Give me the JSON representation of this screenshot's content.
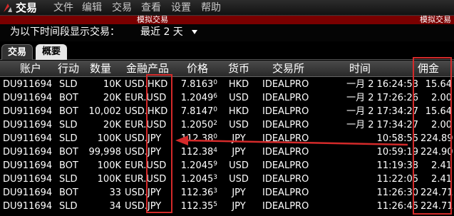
{
  "app": {
    "title": "交易"
  },
  "menu": [
    "文件",
    "编辑",
    "交易",
    "查看",
    "设置",
    "帮助"
  ],
  "simulated_banner": "模拟交易",
  "filter": {
    "label": "为以下时间段显示交易：",
    "value": "最近 2 天"
  },
  "tabs": [
    {
      "label": "交易",
      "active": true
    },
    {
      "label": "概要",
      "active": false
    }
  ],
  "columns": [
    "账户",
    "行动",
    "数量",
    "金融产品",
    "价格",
    "货币",
    "交易所",
    "时间",
    "佣金"
  ],
  "rows": [
    {
      "account": "DU911694",
      "action": "SLD",
      "qty": "10K",
      "symbol": "USD.HKD",
      "price_main": "7.8163",
      "price_sup": "0",
      "currency": "HKD",
      "exchange": "IDEALPRO",
      "time": "一月 2 16:24:53",
      "commission": "15.64"
    },
    {
      "account": "DU911694",
      "action": "BOT",
      "qty": "20K",
      "symbol": "EUR.USD",
      "price_main": "1.2049",
      "price_sup": "6",
      "currency": "USD",
      "exchange": "IDEALPRO",
      "time": "一月 2 17:26:26",
      "commission": "2.00"
    },
    {
      "account": "DU911694",
      "action": "BOT",
      "qty": "10,002",
      "symbol": "USD.HKD",
      "price_main": "7.8147",
      "price_sup": "0",
      "currency": "HKD",
      "exchange": "IDEALPRO",
      "time": "一月 2 17:34:27",
      "commission": "15.64"
    },
    {
      "account": "DU911694",
      "action": "SLD",
      "qty": "20K",
      "symbol": "EUR.USD",
      "price_main": "1.2050",
      "price_sup": "2",
      "currency": "USD",
      "exchange": "IDEALPRO",
      "time": "一月 2 17:34:27",
      "commission": "2.00"
    },
    {
      "account": "DU911694",
      "action": "SLD",
      "qty": "100K",
      "symbol": "USD.JPY",
      "price_main": "112.38",
      "price_sup": "0",
      "currency": "JPY",
      "exchange": "IDEALPRO",
      "time": "10:58:55",
      "commission": "224.89"
    },
    {
      "account": "DU911694",
      "action": "BOT",
      "qty": "99,998",
      "symbol": "USD.JPY",
      "price_main": "112.38",
      "price_sup": "4",
      "currency": "JPY",
      "exchange": "IDEALPRO",
      "time": "10:59:19",
      "commission": "224.90"
    },
    {
      "account": "DU911694",
      "action": "BOT",
      "qty": "100K",
      "symbol": "EUR.USD",
      "price_main": "1.2045",
      "price_sup": "9",
      "currency": "USD",
      "exchange": "IDEALPRO",
      "time": "11:19:38",
      "commission": "2.41"
    },
    {
      "account": "DU911694",
      "action": "SLD",
      "qty": "100K",
      "symbol": "EUR.USD",
      "price_main": "1.2045",
      "price_sup": "3",
      "currency": "USD",
      "exchange": "IDEALPRO",
      "time": "11:22:05",
      "commission": "2.41"
    },
    {
      "account": "DU911694",
      "action": "BOT",
      "qty": "33",
      "symbol": "USD.JPY",
      "price_main": "112.36",
      "price_sup": "3",
      "currency": "JPY",
      "exchange": "IDEALPRO",
      "time": "11:26:30",
      "commission": "224.71"
    },
    {
      "account": "DU911694",
      "action": "SLD",
      "qty": "34",
      "symbol": "USD.JPY",
      "price_main": "112.35",
      "price_sup": "5",
      "currency": "JPY",
      "exchange": "IDEALPRO",
      "time": "11:26:45",
      "commission": "224.71"
    }
  ],
  "colors": {
    "background": "#000000",
    "banner": "#7a0000",
    "annotation": "#d42a2a"
  }
}
